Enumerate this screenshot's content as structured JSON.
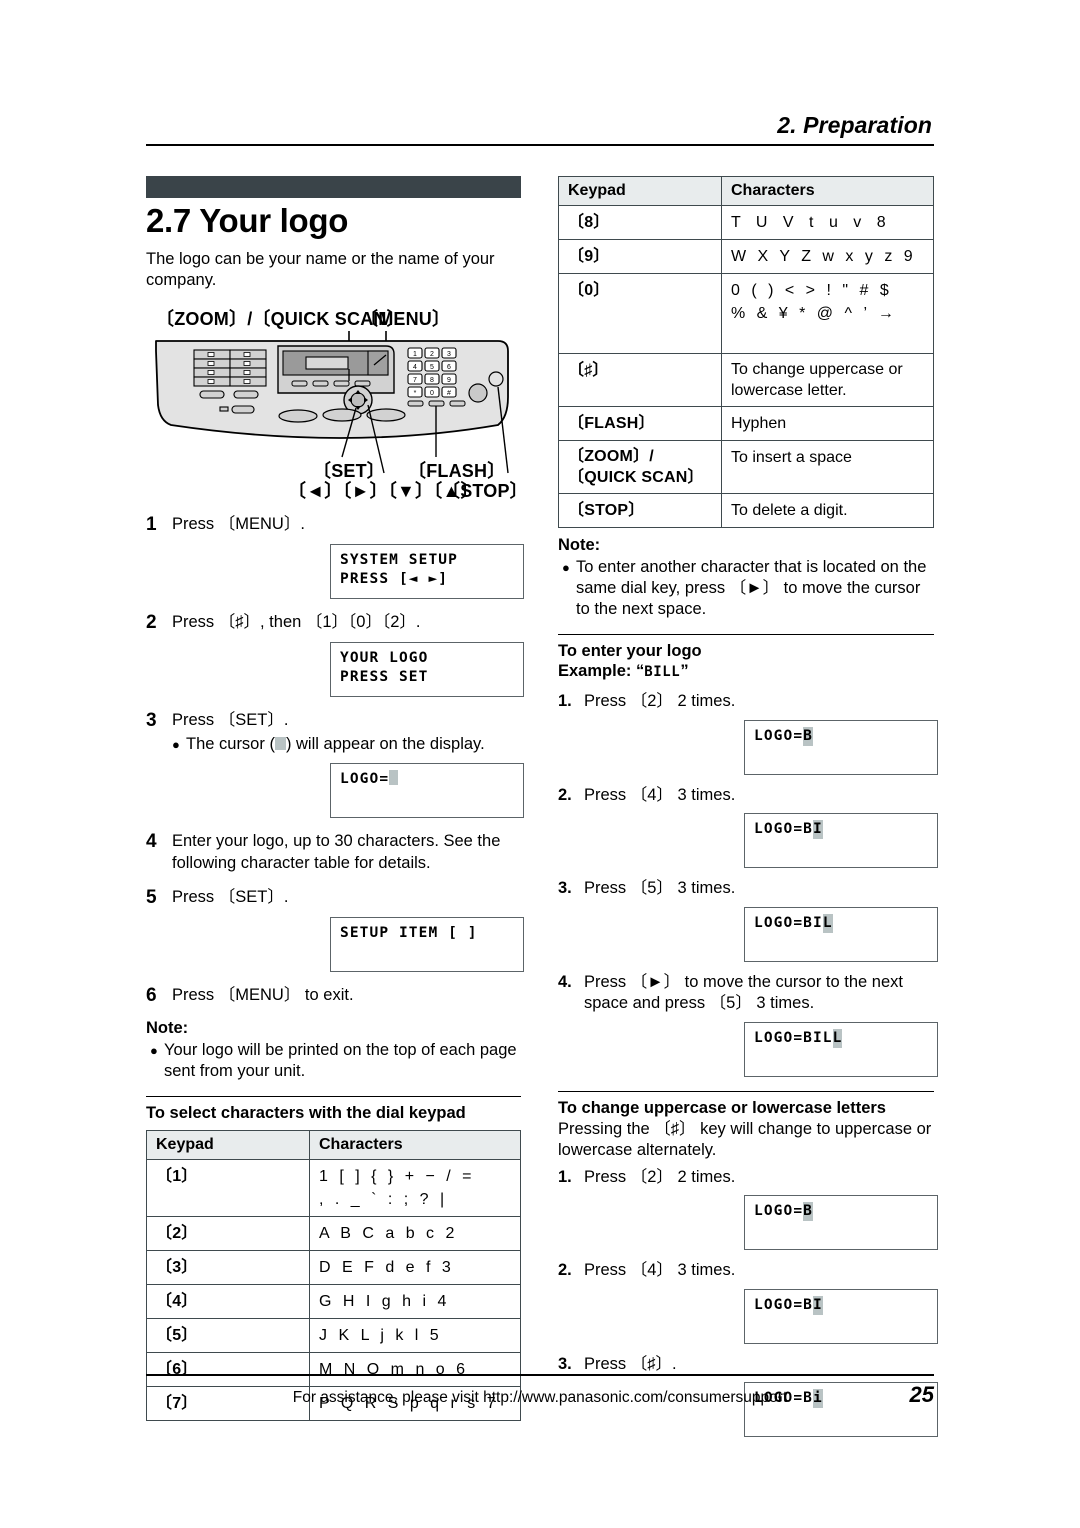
{
  "header": {
    "chapter_title": "2. Preparation"
  },
  "section": {
    "number_title": "2.7 Your logo",
    "intro": "The logo can be your name or the name of your company."
  },
  "illustration": {
    "label_zoom_quickscan": "〔ZOOM〕/〔QUICK SCAN〕",
    "label_menu": "〔MENU〕",
    "label_set": "〔SET〕",
    "label_flash": "〔FLASH〕",
    "label_arrows": "〔◄〕〔►〕〔▼〕〔▲〕",
    "label_stop": "〔STOP〕"
  },
  "steps": [
    {
      "num": "1",
      "text": "Press 〔MENU〕.",
      "lcd": {
        "line1": "SYSTEM SETUP",
        "line2": "PRESS [◄ ►]"
      }
    },
    {
      "num": "2",
      "text": "Press 〔♯〕, then 〔1〕〔0〕〔2〕.",
      "lcd": {
        "line1": "YOUR LOGO",
        "line2": "PRESS SET"
      }
    },
    {
      "num": "3",
      "text": "Press 〔SET〕.",
      "bullet": "The cursor ( ) will appear on the display.",
      "lcd": {
        "line1": "LOGO=",
        "line2": ""
      }
    },
    {
      "num": "4",
      "text": "Enter your logo, up to 30 characters. See the following character table for details."
    },
    {
      "num": "5",
      "text": "Press 〔SET〕.",
      "lcd": {
        "line1": "SETUP ITEM [    ]",
        "line2": ""
      }
    },
    {
      "num": "6",
      "text": "Press 〔MENU〕 to exit."
    }
  ],
  "note_left": {
    "heading": "Note:",
    "items": [
      "Your logo will be printed on the top of each page sent from your unit."
    ]
  },
  "keypad_table_left": {
    "heading": "To select characters with the dial keypad",
    "columns": [
      "Keypad",
      "Characters"
    ],
    "rows": [
      {
        "key": "〔1〕",
        "chars": "1 [ ] { } + − / =",
        "chars2": ", . _ ` : ; ? |"
      },
      {
        "key": "〔2〕",
        "chars": "A B C a b c 2"
      },
      {
        "key": "〔3〕",
        "chars": "D E F d e f 3"
      },
      {
        "key": "〔4〕",
        "chars": "G H I g h i 4"
      },
      {
        "key": "〔5〕",
        "chars": "J K L j k l 5"
      },
      {
        "key": "〔6〕",
        "chars": "M N O m n o 6"
      },
      {
        "key": "〔7〕",
        "chars": "P Q R S p q r s 7"
      }
    ]
  },
  "keypad_table_right": {
    "columns": [
      "Keypad",
      "Characters"
    ],
    "rows": [
      {
        "key": "〔8〕",
        "chars": "T U V t u v 8"
      },
      {
        "key": "〔9〕",
        "chars": "W X Y Z w x y z 9"
      },
      {
        "key": "〔0〕",
        "chars": "0 ( ) < > ! \" # $",
        "chars2": "% & ¥ * @ ^ ’ →"
      },
      {
        "key": "〔♯〕",
        "chars": "To change uppercase or lowercase letter."
      },
      {
        "key": "〔FLASH〕",
        "chars": "Hyphen"
      },
      {
        "key": "〔ZOOM〕/",
        "key2": "〔QUICK SCAN〕",
        "chars": "To insert a space"
      },
      {
        "key": "〔STOP〕",
        "chars": "To delete a digit."
      }
    ]
  },
  "note_right": {
    "heading": "Note:",
    "items": [
      "To enter another character that is located on the same dial key, press 〔►〕 to move the cursor to the next space."
    ]
  },
  "enter_logo": {
    "heading": "To enter your logo",
    "example_label": "Example: “",
    "example_value": "BILL",
    "example_close": "”",
    "steps": [
      {
        "num": "1.",
        "text": "Press 〔2〕 2 times.",
        "lcd_prefix": "LOGO=",
        "lcd_cursor": "B"
      },
      {
        "num": "2.",
        "text": "Press 〔4〕 3 times.",
        "lcd_prefix": "LOGO=B",
        "lcd_cursor": "I"
      },
      {
        "num": "3.",
        "text": "Press 〔5〕 3 times.",
        "lcd_prefix": "LOGO=BI",
        "lcd_cursor": "L"
      },
      {
        "num": "4.",
        "text": "Press 〔►〕 to move the cursor to the next space and press 〔5〕 3 times.",
        "lcd_prefix": "LOGO=BIL",
        "lcd_cursor": "L"
      }
    ]
  },
  "change_case": {
    "heading": "To change uppercase or lowercase letters",
    "intro": "Pressing the 〔♯〕 key will change to uppercase or lowercase alternately.",
    "steps": [
      {
        "num": "1.",
        "text": "Press 〔2〕 2 times.",
        "lcd_prefix": "LOGO=",
        "lcd_cursor": "B"
      },
      {
        "num": "2.",
        "text": "Press 〔4〕 3 times.",
        "lcd_prefix": "LOGO=B",
        "lcd_cursor": "I"
      },
      {
        "num": "3.",
        "text": "Press 〔♯〕.",
        "lcd_prefix": "LOGO=B",
        "lcd_cursor": "i"
      }
    ]
  },
  "footer": {
    "assistance": "For assistance, please visit http://www.panasonic.com/consumersupport",
    "page_number": "25"
  },
  "colors": {
    "title_bar": "#3a4449",
    "table_header_bg": "#e8eced",
    "cursor_highlight": "#b9c3c4",
    "rule": "#000000"
  }
}
